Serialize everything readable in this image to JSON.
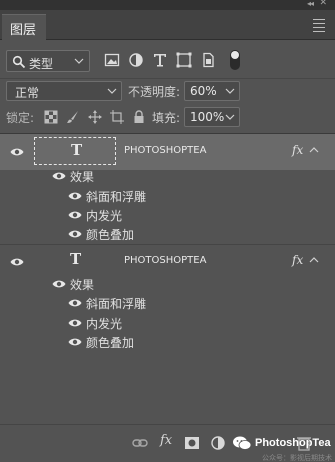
{
  "panel": {
    "tab_label": "图层",
    "collapse_glyph": "◂◂",
    "close_glyph": "✕"
  },
  "filter": {
    "kind_label": "类型",
    "icons": [
      "image-filter-icon",
      "adjustment-filter-icon",
      "type-filter-icon",
      "shape-filter-icon",
      "smart-object-filter-icon"
    ],
    "toggle_on": true
  },
  "blend": {
    "mode": "正常",
    "opacity_label": "不透明度:",
    "opacity_value": "60%"
  },
  "lock": {
    "label": "锁定:",
    "icons": [
      "lock-transparent-icon",
      "lock-paint-icon",
      "lock-position-icon",
      "lock-artboard-icon",
      "lock-all-icon"
    ],
    "fill_label": "填充:",
    "fill_value": "100%"
  },
  "layers": [
    {
      "name": "PHOTOSHOPTEA",
      "thumb_glyph": "T",
      "selected": true,
      "fx_label": "fx",
      "effects_label": "效果",
      "effects": [
        "斜面和浮雕",
        "内发光",
        "颜色叠加"
      ]
    },
    {
      "name": "PHOTOSHOPTEA",
      "thumb_glyph": "T",
      "selected": false,
      "fx_label": "fx",
      "effects_label": "效果",
      "effects": [
        "斜面和浮雕",
        "内发光",
        "颜色叠加"
      ]
    }
  ],
  "bottom": {
    "icons": [
      "link-layers-icon",
      "add-style-icon",
      "add-mask-icon",
      "adjustment-layer-icon",
      "new-group-icon",
      "new-layer-icon",
      "delete-layer-icon"
    ],
    "fx_label": "fx",
    "watermark": "PhotoshopTea",
    "watermark_sub": "公众号：影视后期技术讲解"
  }
}
